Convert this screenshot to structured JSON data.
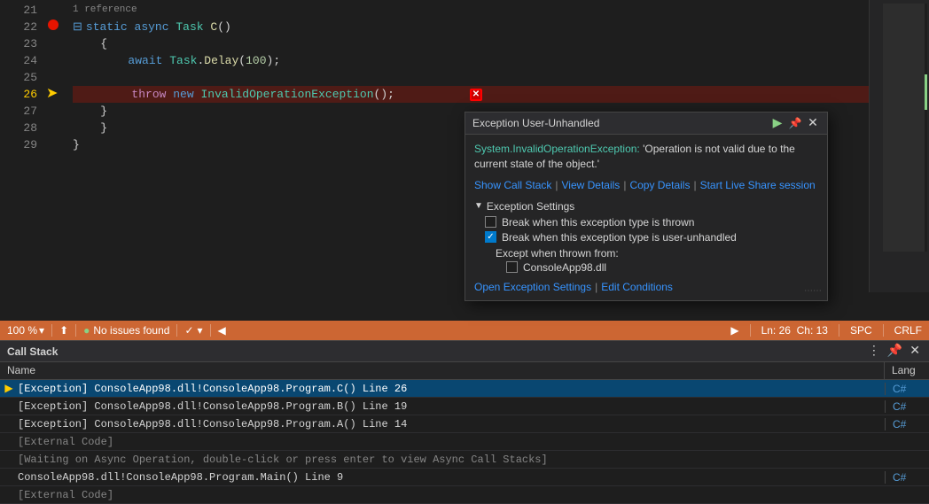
{
  "editor": {
    "lines": [
      {
        "num": "21",
        "content": "",
        "type": "normal",
        "hasRef": true,
        "ref": "1 reference"
      },
      {
        "num": "22",
        "content": "    static async Task C()",
        "type": "normal",
        "hasCollapse": true
      },
      {
        "num": "23",
        "content": "    {",
        "type": "normal"
      },
      {
        "num": "24",
        "content": "        await Task.Delay(100);",
        "type": "normal"
      },
      {
        "num": "25",
        "content": "",
        "type": "normal"
      },
      {
        "num": "26",
        "content": "        throw new InvalidOperationException();",
        "type": "exception",
        "hasArrow": true
      },
      {
        "num": "27",
        "content": "    }",
        "type": "normal"
      },
      {
        "num": "28",
        "content": "    }",
        "type": "normal"
      },
      {
        "num": "29",
        "content": "}",
        "type": "normal"
      }
    ]
  },
  "exception_popup": {
    "title": "Exception User-Unhandled",
    "message_prefix": "System.InvalidOperationException:",
    "message_body": " 'Operation is not valid due to the current state of the object.'",
    "links": {
      "show_call_stack": "Show Call Stack",
      "view_details": "View Details",
      "copy_details": "Copy Details",
      "start_live_share": "Start Live Share session"
    },
    "settings": {
      "header": "Exception Settings",
      "cb1_label": "Break when this exception type is thrown",
      "cb1_checked": false,
      "cb2_label": "Break when this exception type is user-unhandled",
      "cb2_checked": true,
      "except_when_label": "Except when thrown from:",
      "dll_label": "ConsoleApp98.dll",
      "open_settings_link": "Open Exception Settings",
      "edit_conditions_link": "Edit Conditions"
    }
  },
  "status_bar": {
    "zoom": "100 %",
    "git_icon": "⬆",
    "no_issues": "No issues found",
    "check_icon": "✓",
    "nav_prev": "◀",
    "nav_next": "▶",
    "ln": "Ln: 26",
    "ch": "Ch: 13",
    "spc": "SPC",
    "crlf": "CRLF"
  },
  "callstack": {
    "title": "Call Stack",
    "columns": {
      "name": "Name",
      "lang": "Lang"
    },
    "rows": [
      {
        "icon": "▶",
        "name": "[Exception] ConsoleApp98.dll!ConsoleApp98.Program.C() Line 26",
        "lang": "C#",
        "active": true
      },
      {
        "icon": "",
        "name": "[Exception] ConsoleApp98.dll!ConsoleApp98.Program.B() Line 19",
        "lang": "C#",
        "active": false
      },
      {
        "icon": "",
        "name": "[Exception] ConsoleApp98.dll!ConsoleApp98.Program.A() Line 14",
        "lang": "C#",
        "active": false
      },
      {
        "icon": "",
        "name": "[External Code]",
        "lang": "",
        "active": false
      },
      {
        "icon": "",
        "name": "[Waiting on Async Operation, double-click or press enter to view Async Call Stacks]",
        "lang": "",
        "active": false
      },
      {
        "icon": "",
        "name": "ConsoleApp98.dll!ConsoleApp98.Program.Main() Line 9",
        "lang": "C#",
        "active": false
      },
      {
        "icon": "",
        "name": "[External Code]",
        "lang": "",
        "active": false
      }
    ]
  }
}
